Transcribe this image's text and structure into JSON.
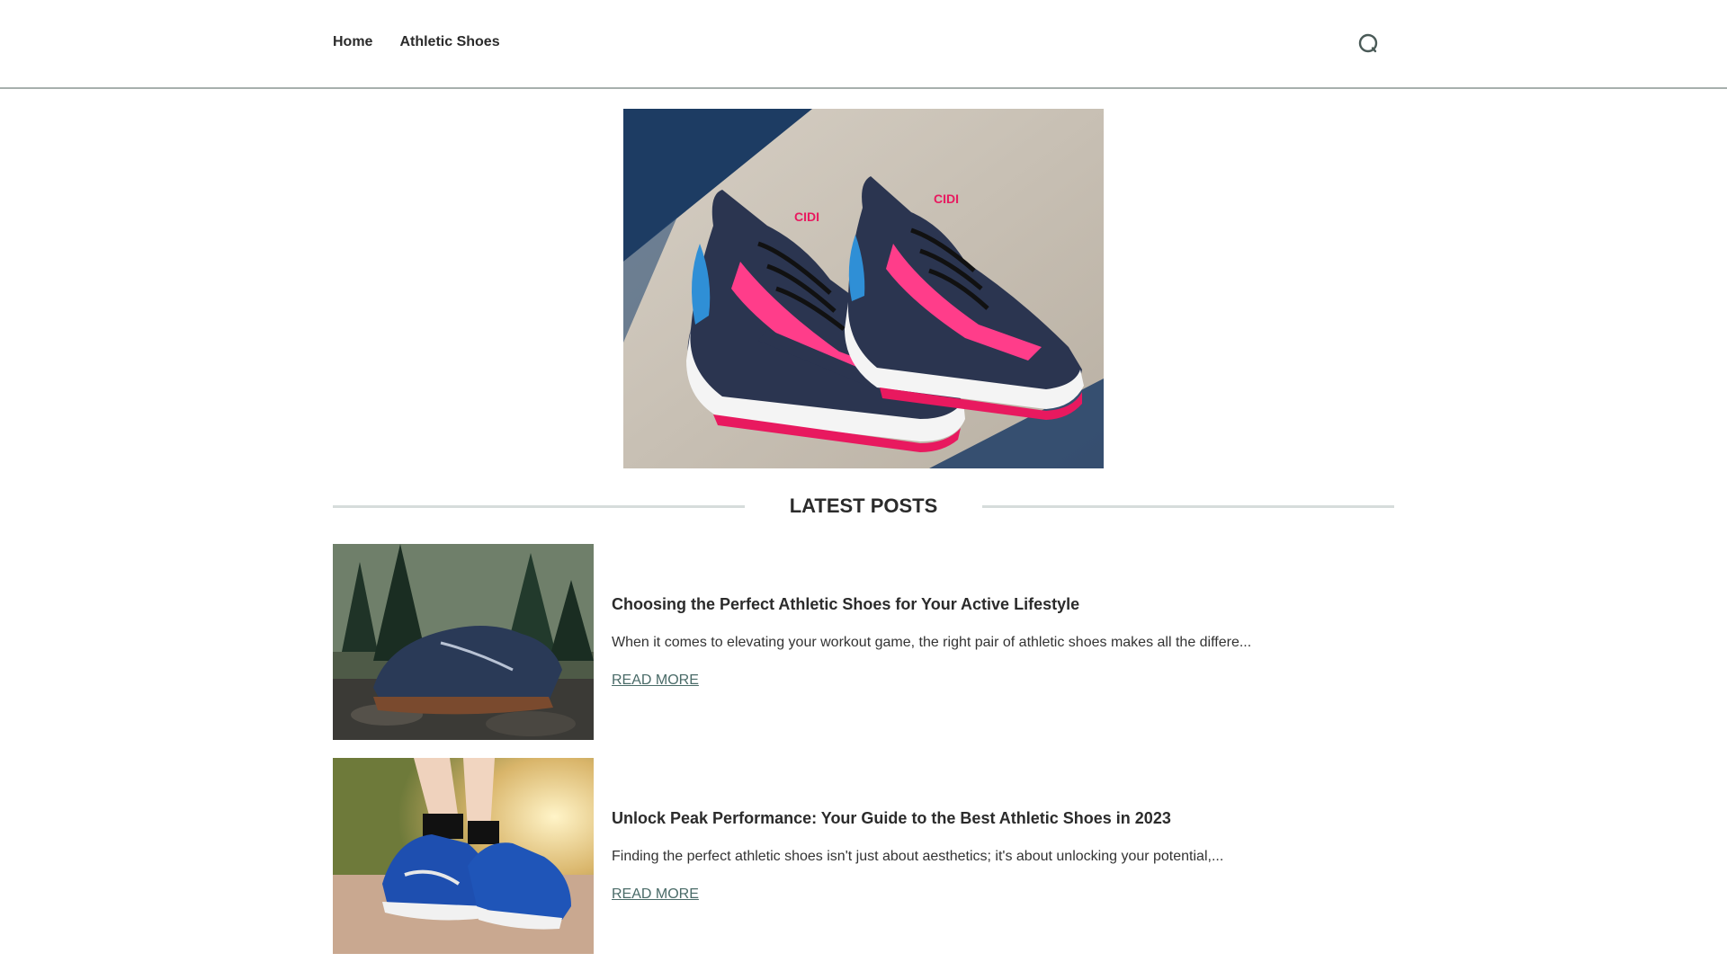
{
  "nav": {
    "items": [
      {
        "label": "Home"
      },
      {
        "label": "Athletic Shoes"
      }
    ]
  },
  "search": {
    "icon": "search-icon"
  },
  "section": {
    "title": "LATEST POSTS"
  },
  "posts": [
    {
      "title": "Choosing the Perfect Athletic Shoes for Your Active Lifestyle",
      "excerpt": "When it comes to elevating your workout game, the right pair of athletic shoes makes all the differe...",
      "read_more": "READ MORE"
    },
    {
      "title": "Unlock Peak Performance: Your Guide to the Best Athletic Shoes in 2023",
      "excerpt": "Finding the perfect athletic shoes isn't just about aesthetics; it's about unlocking your potential,...",
      "read_more": "READ MORE"
    }
  ],
  "colors": {
    "accent_link": "#4a6b68",
    "divider": "#d6dcdb",
    "text": "#2b2b2b"
  }
}
